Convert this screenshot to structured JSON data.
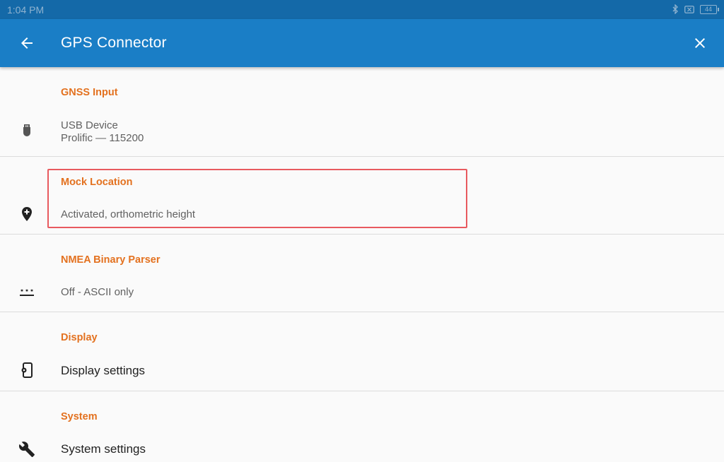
{
  "status_bar": {
    "time": "1:04 PM",
    "battery": "44",
    "icons": [
      "bluetooth-icon",
      "sim-icon",
      "battery-icon"
    ]
  },
  "app_bar": {
    "title": "GPS Connector",
    "back_icon": "arrow-back-icon",
    "close_icon": "close-icon"
  },
  "settings": [
    {
      "category": "GNSS Input",
      "lines": [
        "USB Device",
        "Prolific — 115200"
      ],
      "icon": "usb-icon"
    },
    {
      "category": "Mock Location",
      "lines": [
        "Activated, orthometric height"
      ],
      "icon": "add-location-icon"
    },
    {
      "category": "NMEA Binary Parser",
      "lines": [
        "Off - ASCII only"
      ],
      "icon": "password-dots-icon"
    },
    {
      "category": "Display",
      "lines": [
        "Display settings"
      ],
      "icon": "phone-settings-icon"
    },
    {
      "category": "System",
      "lines": [
        "System settings"
      ],
      "icon": "wrench-icon"
    }
  ],
  "colors": {
    "app_bar": "#1a7ec6",
    "status_bar": "#1469a8",
    "category_text": "#e3711f",
    "highlight": "#e85a5f"
  }
}
